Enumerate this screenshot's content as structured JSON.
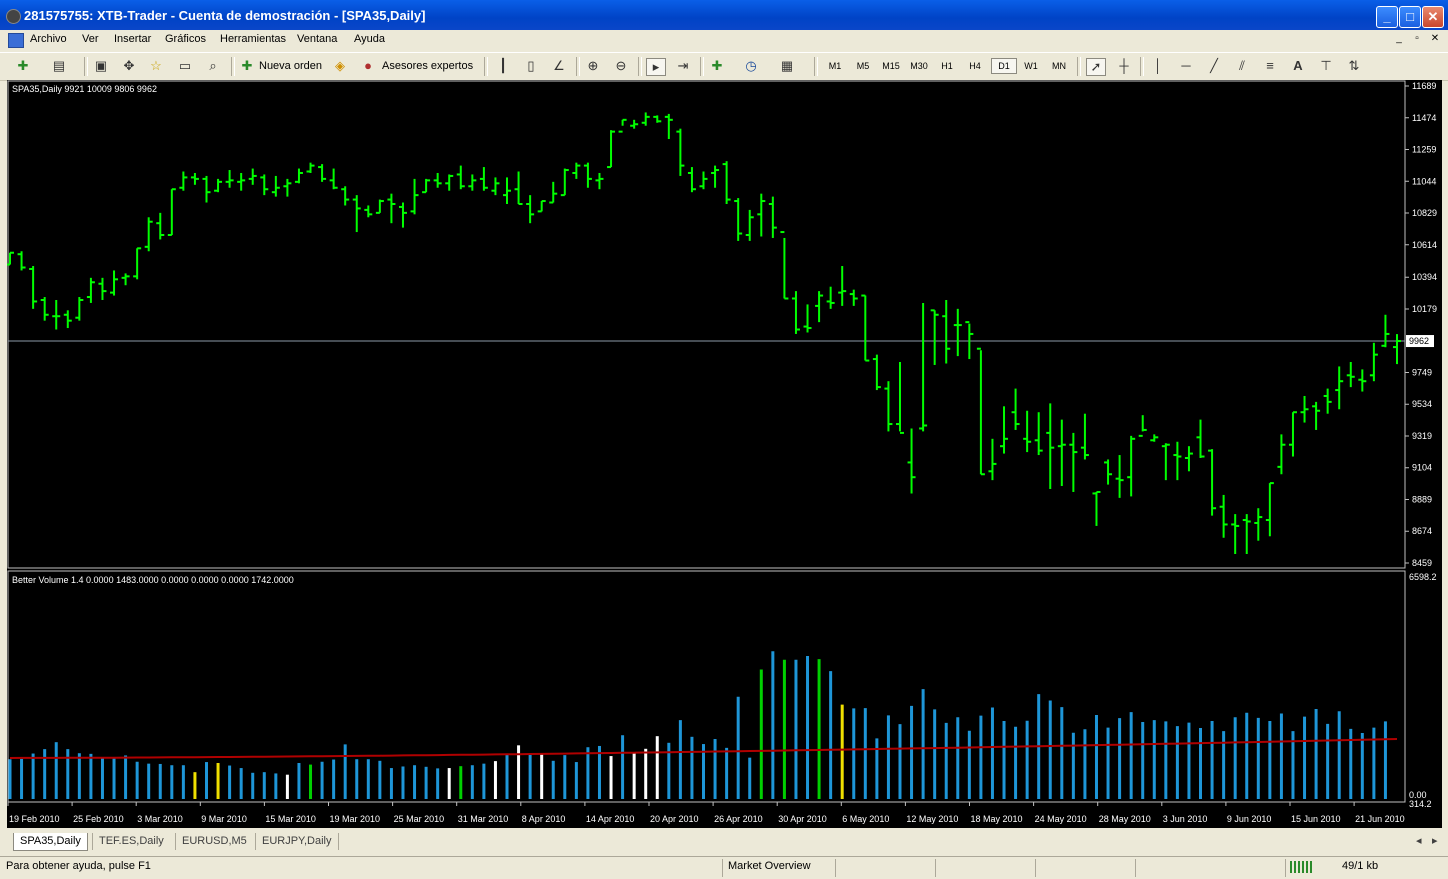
{
  "window": {
    "title": "281575755: XTB-Trader - Cuenta de demostración - [SPA35,Daily]",
    "buttons": {
      "minimize": "_",
      "maximize": "□",
      "close": "✕"
    }
  },
  "menu": {
    "items": [
      "Archivo",
      "Ver",
      "Insertar",
      "Gráficos",
      "Herramientas",
      "Ventana",
      "Ayuda"
    ],
    "mdi_buttons": [
      "_",
      "▫",
      "✕"
    ]
  },
  "toolbar": {
    "new_order": "Nueva orden",
    "expert_advisors": "Asesores expertos",
    "timeframes": [
      "M1",
      "M5",
      "M15",
      "M30",
      "H1",
      "H4",
      "D1",
      "W1",
      "MN"
    ],
    "selected_timeframe": "D1",
    "text_tool": "A"
  },
  "chart_data": {
    "type": "ohlc",
    "symbol_label": "SPA35,Daily",
    "ohlc_label": "9921 10009 9806 9962",
    "current_price": "9962",
    "price_axis": [
      "11689",
      "11474",
      "11259",
      "11044",
      "10829",
      "10614",
      "10394",
      "10179",
      "9749",
      "9534",
      "9319",
      "9104",
      "8889",
      "8674",
      "8459"
    ],
    "ylim": [
      8459,
      11689
    ],
    "x_labels": [
      "19 Feb 2010",
      "25 Feb 2010",
      "3 Mar 2010",
      "9 Mar 2010",
      "15 Mar 2010",
      "19 Mar 2010",
      "25 Mar 2010",
      "31 Mar 2010",
      "8 Apr 2010",
      "14 Apr 2010",
      "20 Apr 2010",
      "26 Apr 2010",
      "30 Apr 2010",
      "6 May 2010",
      "12 May 2010",
      "18 May 2010",
      "24 May 2010",
      "28 May 2010",
      "3 Jun 2010",
      "9 Jun 2010",
      "15 Jun 2010",
      "21 Jun 2010"
    ],
    "bars": [
      {
        "o": 10480,
        "h": 10560,
        "l": 10480,
        "c": 10560
      },
      {
        "o": 10550,
        "h": 10570,
        "l": 10440,
        "c": 10460
      },
      {
        "o": 10450,
        "h": 10470,
        "l": 10180,
        "c": 10230
      },
      {
        "o": 10240,
        "h": 10260,
        "l": 10100,
        "c": 10140
      },
      {
        "o": 10130,
        "h": 10240,
        "l": 10040,
        "c": 10130
      },
      {
        "o": 10140,
        "h": 10170,
        "l": 10050,
        "c": 10100
      },
      {
        "o": 10120,
        "h": 10260,
        "l": 10100,
        "c": 10240
      },
      {
        "o": 10260,
        "h": 10390,
        "l": 10220,
        "c": 10360
      },
      {
        "o": 10350,
        "h": 10390,
        "l": 10240,
        "c": 10300
      },
      {
        "o": 10290,
        "h": 10440,
        "l": 10270,
        "c": 10380
      },
      {
        "o": 10390,
        "h": 10420,
        "l": 10340,
        "c": 10400
      },
      {
        "o": 10400,
        "h": 10590,
        "l": 10380,
        "c": 10590
      },
      {
        "o": 10600,
        "h": 10800,
        "l": 10570,
        "c": 10770
      },
      {
        "o": 10760,
        "h": 10830,
        "l": 10650,
        "c": 10680
      },
      {
        "o": 10680,
        "h": 10990,
        "l": 10680,
        "c": 10990
      },
      {
        "o": 11000,
        "h": 11110,
        "l": 10980,
        "c": 11070
      },
      {
        "o": 11070,
        "h": 11100,
        "l": 11020,
        "c": 11060
      },
      {
        "o": 11060,
        "h": 11080,
        "l": 10900,
        "c": 10970
      },
      {
        "o": 10980,
        "h": 11060,
        "l": 10970,
        "c": 11040
      },
      {
        "o": 11040,
        "h": 11120,
        "l": 11000,
        "c": 11050
      },
      {
        "o": 11040,
        "h": 11100,
        "l": 10980,
        "c": 11050
      },
      {
        "o": 11060,
        "h": 11130,
        "l": 11020,
        "c": 11080
      },
      {
        "o": 11070,
        "h": 11090,
        "l": 10950,
        "c": 10990
      },
      {
        "o": 10970,
        "h": 11080,
        "l": 10940,
        "c": 11000
      },
      {
        "o": 11010,
        "h": 11060,
        "l": 10940,
        "c": 11030
      },
      {
        "o": 11040,
        "h": 11130,
        "l": 11030,
        "c": 11100
      },
      {
        "o": 11110,
        "h": 11170,
        "l": 11100,
        "c": 11150
      },
      {
        "o": 11140,
        "h": 11160,
        "l": 11040,
        "c": 11060
      },
      {
        "o": 11050,
        "h": 11130,
        "l": 10990,
        "c": 11000
      },
      {
        "o": 10990,
        "h": 11010,
        "l": 10880,
        "c": 10920
      },
      {
        "o": 10920,
        "h": 10950,
        "l": 10700,
        "c": 10860
      },
      {
        "o": 10850,
        "h": 10880,
        "l": 10800,
        "c": 10820
      },
      {
        "o": 10830,
        "h": 10920,
        "l": 10830,
        "c": 10910
      },
      {
        "o": 10920,
        "h": 10960,
        "l": 10760,
        "c": 10890
      },
      {
        "o": 10870,
        "h": 10900,
        "l": 10730,
        "c": 10830
      },
      {
        "o": 10840,
        "h": 11060,
        "l": 10820,
        "c": 10950
      },
      {
        "o": 10970,
        "h": 11060,
        "l": 10970,
        "c": 11050
      },
      {
        "o": 11050,
        "h": 11100,
        "l": 11000,
        "c": 11030
      },
      {
        "o": 11030,
        "h": 11090,
        "l": 10980,
        "c": 11080
      },
      {
        "o": 11090,
        "h": 11150,
        "l": 10990,
        "c": 11010
      },
      {
        "o": 11010,
        "h": 11090,
        "l": 10980,
        "c": 11050
      },
      {
        "o": 11060,
        "h": 11140,
        "l": 10980,
        "c": 11000
      },
      {
        "o": 10980,
        "h": 11070,
        "l": 10950,
        "c": 11030
      },
      {
        "o": 10950,
        "h": 11070,
        "l": 10890,
        "c": 10980
      },
      {
        "o": 10990,
        "h": 11110,
        "l": 10890,
        "c": 10890
      },
      {
        "o": 10890,
        "h": 10950,
        "l": 10760,
        "c": 10820
      },
      {
        "o": 10840,
        "h": 10910,
        "l": 10840,
        "c": 10910
      },
      {
        "o": 10900,
        "h": 11040,
        "l": 10900,
        "c": 10960
      },
      {
        "o": 10950,
        "h": 11130,
        "l": 10950,
        "c": 11120
      },
      {
        "o": 11100,
        "h": 11170,
        "l": 11060,
        "c": 11150
      },
      {
        "o": 11150,
        "h": 11170,
        "l": 11000,
        "c": 11060
      },
      {
        "o": 11050,
        "h": 11100,
        "l": 10990,
        "c": 11060
      },
      {
        "o": 11140,
        "h": 11390,
        "l": 11140,
        "c": 11380
      },
      {
        "o": 11380,
        "h": 11460,
        "l": 11420,
        "c": 11460
      },
      {
        "o": 11420,
        "h": 11460,
        "l": 11400,
        "c": 11430
      },
      {
        "o": 11440,
        "h": 11510,
        "l": 11420,
        "c": 11480
      },
      {
        "o": 11480,
        "h": 11490,
        "l": 11440,
        "c": 11450
      },
      {
        "o": 11480,
        "h": 11500,
        "l": 11330,
        "c": 11460
      },
      {
        "o": 11380,
        "h": 11400,
        "l": 11080,
        "c": 11150
      },
      {
        "o": 11100,
        "h": 11140,
        "l": 10970,
        "c": 10990
      },
      {
        "o": 11010,
        "h": 11110,
        "l": 10990,
        "c": 11060
      },
      {
        "o": 11100,
        "h": 11150,
        "l": 11000,
        "c": 11120
      },
      {
        "o": 11160,
        "h": 11180,
        "l": 10890,
        "c": 10920
      },
      {
        "o": 10910,
        "h": 10930,
        "l": 10640,
        "c": 10690
      },
      {
        "o": 10680,
        "h": 10850,
        "l": 10640,
        "c": 10800
      },
      {
        "o": 10820,
        "h": 10960,
        "l": 10670,
        "c": 10910
      },
      {
        "o": 10890,
        "h": 10940,
        "l": 10660,
        "c": 10730
      },
      {
        "o": 10700,
        "h": 10660,
        "l": 10250,
        "c": 10250
      },
      {
        "o": 10250,
        "h": 10300,
        "l": 10010,
        "c": 10040
      },
      {
        "o": 10060,
        "h": 10210,
        "l": 10020,
        "c": 10050
      },
      {
        "o": 10200,
        "h": 10300,
        "l": 10090,
        "c": 10270
      },
      {
        "o": 10230,
        "h": 10330,
        "l": 10180,
        "c": 10220
      },
      {
        "o": 10290,
        "h": 10470,
        "l": 10200,
        "c": 10300
      },
      {
        "o": 10280,
        "h": 10310,
        "l": 10200,
        "c": 10250
      },
      {
        "o": 10270,
        "h": 10270,
        "l": 9830,
        "c": 9830
      },
      {
        "o": 9840,
        "h": 9870,
        "l": 9630,
        "c": 9650
      },
      {
        "o": 9640,
        "h": 9690,
        "l": 9350,
        "c": 9400
      },
      {
        "o": 9400,
        "h": 9820,
        "l": 9350,
        "c": 9340
      },
      {
        "o": 9140,
        "h": 9370,
        "l": 8930,
        "c": 9040
      },
      {
        "o": 9370,
        "h": 10220,
        "l": 9350,
        "c": 9390
      },
      {
        "o": 10170,
        "h": 10170,
        "l": 9800,
        "c": 10140
      },
      {
        "o": 10130,
        "h": 10240,
        "l": 9810,
        "c": 9910
      },
      {
        "o": 10070,
        "h": 10180,
        "l": 9860,
        "c": 10070
      },
      {
        "o": 10090,
        "h": 10080,
        "l": 9840,
        "c": 10010
      },
      {
        "o": 9910,
        "h": 9900,
        "l": 9060,
        "c": 9060
      },
      {
        "o": 9080,
        "h": 9300,
        "l": 9020,
        "c": 9130
      },
      {
        "o": 9250,
        "h": 9520,
        "l": 9200,
        "c": 9300
      },
      {
        "o": 9480,
        "h": 9640,
        "l": 9360,
        "c": 9400
      },
      {
        "o": 9300,
        "h": 9490,
        "l": 9210,
        "c": 9280
      },
      {
        "o": 9290,
        "h": 9480,
        "l": 9190,
        "c": 9220
      },
      {
        "o": 9340,
        "h": 9540,
        "l": 8960,
        "c": 9240
      },
      {
        "o": 9250,
        "h": 9430,
        "l": 8980,
        "c": 9260
      },
      {
        "o": 9260,
        "h": 9340,
        "l": 8940,
        "c": 9210
      },
      {
        "o": 9240,
        "h": 9470,
        "l": 9160,
        "c": 9190
      },
      {
        "o": 8930,
        "h": 8940,
        "l": 8710,
        "c": 8940
      },
      {
        "o": 9140,
        "h": 9160,
        "l": 8990,
        "c": 9060
      },
      {
        "o": 9030,
        "h": 9190,
        "l": 8900,
        "c": 9020
      },
      {
        "o": 9040,
        "h": 9320,
        "l": 8910,
        "c": 9300
      },
      {
        "o": 9320,
        "h": 9460,
        "l": 9350,
        "c": 9360
      },
      {
        "o": 9290,
        "h": 9330,
        "l": 9280,
        "c": 9310
      },
      {
        "o": 9250,
        "h": 9270,
        "l": 9020,
        "c": 9260
      },
      {
        "o": 9190,
        "h": 9280,
        "l": 9020,
        "c": 9180
      },
      {
        "o": 9170,
        "h": 9250,
        "l": 9080,
        "c": 9200
      },
      {
        "o": 9310,
        "h": 9430,
        "l": 9170,
        "c": 9180
      },
      {
        "o": 9220,
        "h": 9230,
        "l": 8780,
        "c": 8830
      },
      {
        "o": 8840,
        "h": 8920,
        "l": 8630,
        "c": 8720
      },
      {
        "o": 8720,
        "h": 8790,
        "l": 8520,
        "c": 8710
      },
      {
        "o": 8750,
        "h": 8790,
        "l": 8520,
        "c": 8740
      },
      {
        "o": 8730,
        "h": 8830,
        "l": 8610,
        "c": 8770
      },
      {
        "o": 8750,
        "h": 9000,
        "l": 8640,
        "c": 9000
      },
      {
        "o": 9110,
        "h": 9330,
        "l": 9060,
        "c": 9260
      },
      {
        "o": 9260,
        "h": 9480,
        "l": 9180,
        "c": 9480
      },
      {
        "o": 9480,
        "h": 9590,
        "l": 9410,
        "c": 9500
      },
      {
        "o": 9520,
        "h": 9550,
        "l": 9360,
        "c": 9490
      },
      {
        "o": 9590,
        "h": 9640,
        "l": 9470,
        "c": 9550
      },
      {
        "o": 9630,
        "h": 9790,
        "l": 9500,
        "c": 9690
      },
      {
        "o": 9730,
        "h": 9820,
        "l": 9650,
        "c": 9720
      },
      {
        "o": 9700,
        "h": 9770,
        "l": 9620,
        "c": 9690
      },
      {
        "o": 9730,
        "h": 9950,
        "l": 9690,
        "c": 9870
      },
      {
        "o": 9930,
        "h": 10140,
        "l": 9920,
        "c": 10010
      },
      {
        "o": 9921,
        "h": 10009,
        "l": 9806,
        "c": 9962
      }
    ],
    "indicator": {
      "label": "Better Volume 1.4 0.0000 1483.0000 0.0000 0.0000 0.0000 1742.0000",
      "axis_top": "6598.2",
      "axis_mid": "314.2",
      "axis_zero": "0.00",
      "ylim": [
        0,
        7000
      ],
      "values": [
        1260,
        1270,
        1440,
        1580,
        1800,
        1580,
        1450,
        1430,
        1330,
        1280,
        1380,
        1180,
        1120,
        1110,
        1070,
        1070,
        850,
        1170,
        1140,
        1060,
        980,
        830,
        850,
        810,
        770,
        1140,
        1090,
        1180,
        1250,
        1730,
        1260,
        1260,
        1210,
        980,
        1030,
        1070,
        1020,
        970,
        980,
        1040,
        1070,
        1120,
        1200,
        1410,
        1700,
        1440,
        1410,
        1210,
        1390,
        1170,
        1640,
        1680,
        1360,
        2020,
        1450,
        1590,
        1990,
        1780,
        2500,
        1970,
        1740,
        1900,
        1620,
        3240,
        1310,
        4100,
        4680,
        4410,
        4410,
        4530,
        4430,
        4050,
        2990,
        2870,
        2880,
        1920,
        2650,
        2370,
        2950,
        3480,
        2840,
        2410,
        2590,
        2160,
        2640,
        2900,
        2470,
        2290,
        2480,
        3320,
        3120,
        2910,
        2100,
        2210,
        2660,
        2260,
        2560,
        2750,
        2440,
        2500,
        2460,
        2310,
        2420,
        2250,
        2470,
        2150,
        2590,
        2730,
        2570,
        2470,
        2710,
        2150,
        2610,
        2850,
        2380,
        2780,
        2220,
        2090,
        2260,
        2460
      ],
      "colors": [
        "blue",
        "blue",
        "blue",
        "blue",
        "blue",
        "blue",
        "blue",
        "blue",
        "blue",
        "blue",
        "blue",
        "blue",
        "blue",
        "blue",
        "blue",
        "blue",
        "yellow",
        "blue",
        "yellow",
        "blue",
        "blue",
        "blue",
        "blue",
        "blue",
        "white",
        "blue",
        "green",
        "blue",
        "blue",
        "blue",
        "blue",
        "blue",
        "blue",
        "blue",
        "blue",
        "blue",
        "blue",
        "blue",
        "white",
        "green",
        "blue",
        "blue",
        "white",
        "blue",
        "white",
        "blue",
        "white",
        "blue",
        "blue",
        "blue",
        "blue",
        "blue",
        "white",
        "blue",
        "white",
        "white",
        "white",
        "blue",
        "blue",
        "blue",
        "blue",
        "blue",
        "blue",
        "blue",
        "blue",
        "green",
        "blue",
        "green",
        "blue",
        "blue",
        "green",
        "blue",
        "yellow",
        "blue",
        "blue",
        "blue",
        "blue",
        "blue",
        "blue",
        "blue",
        "blue",
        "blue",
        "blue",
        "blue",
        "blue",
        "blue",
        "blue",
        "blue",
        "blue",
        "blue",
        "blue",
        "blue",
        "blue",
        "blue",
        "blue",
        "blue",
        "blue",
        "blue",
        "blue",
        "blue",
        "blue",
        "blue",
        "blue",
        "blue",
        "blue",
        "blue",
        "blue",
        "blue",
        "blue",
        "blue",
        "blue",
        "blue",
        "blue",
        "blue",
        "blue",
        "blue",
        "blue",
        "blue",
        "blue",
        "blue"
      ],
      "ma_start": 1300,
      "ma_end": 1900
    }
  },
  "colors": {
    "bar": "#00ff00",
    "chart_bg": "#000000",
    "axis_text": "#ffffff",
    "volume_blue": "#1e96d8",
    "volume_white": "#ffffff",
    "volume_green": "#00d000",
    "volume_yellow": "#f0e000",
    "ma_line": "#b00000"
  },
  "tabs": [
    "SPA35,Daily",
    "TEF.ES,Daily",
    "EURUSD,M5",
    "EURJPY,Daily"
  ],
  "active_tab": "SPA35,Daily",
  "status": {
    "help": "Para obtener ayuda, pulse F1",
    "profile": "Market Overview",
    "traffic": "49/1 kb"
  }
}
